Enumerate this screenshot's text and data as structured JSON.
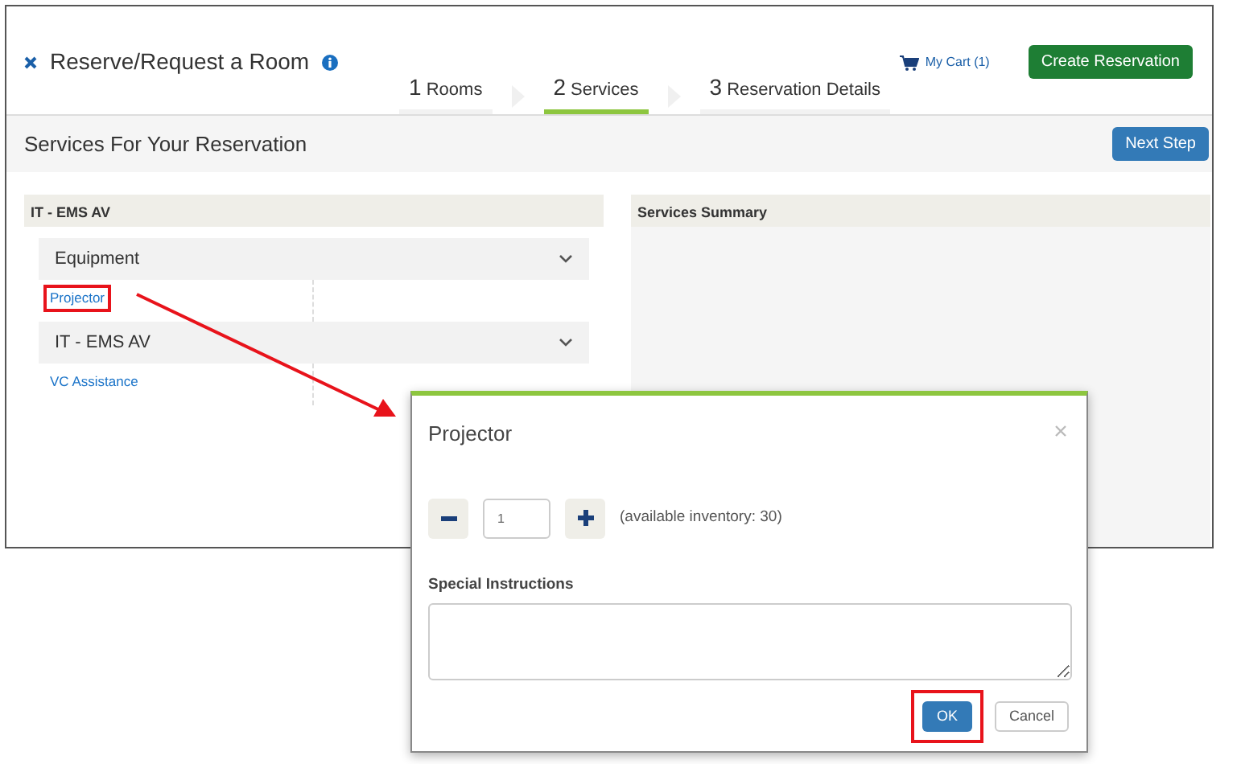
{
  "header": {
    "title": "Reserve/Request a Room",
    "cart": "My Cart (1)",
    "create_button": "Create Reservation"
  },
  "steps": [
    {
      "number": "1",
      "label": "Rooms",
      "selected": false
    },
    {
      "number": "2",
      "label": "Services",
      "selected": true
    },
    {
      "number": "3",
      "label": "Reservation Details",
      "selected": false
    }
  ],
  "band": {
    "title": "Services For Your Reservation",
    "next_button": "Next Step"
  },
  "left_panel": {
    "title": "IT - EMS AV",
    "groups": [
      {
        "title": "Equipment",
        "items": [
          {
            "label": "Projector",
            "highlighted": true
          }
        ]
      },
      {
        "title": "IT - EMS AV",
        "items": [
          {
            "label": "VC Assistance",
            "highlighted": false
          }
        ]
      }
    ]
  },
  "right_panel": {
    "title": "Services Summary"
  },
  "dialog": {
    "title": "Projector",
    "quantity": "1",
    "inventory": "(available inventory: 30)",
    "instructions_label": "Special Instructions",
    "buttons": [
      {
        "label": "OK",
        "kind": "primary",
        "highlighted": true
      },
      {
        "label": "Cancel",
        "kind": "secondary",
        "highlighted": false
      }
    ]
  }
}
